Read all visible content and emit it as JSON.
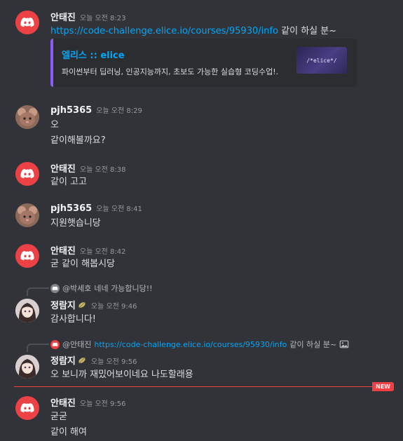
{
  "messages": [
    {
      "username": "안태진",
      "time": "오늘 오전 8:23",
      "link": "https://code-challenge.elice.io/courses/95930/info",
      "text_after_link": " 같이 하실 분~",
      "embed": {
        "title": "엘리스 :: elice",
        "description": "파이썬부터 딥러닝, 인공지능까지, 초보도 가능한 실습형 코딩수업!.",
        "thumb_text": "/*elice*/"
      }
    },
    {
      "username": "pjh5365",
      "time": "오늘 오전 8:29",
      "lines": [
        "오",
        "같이해볼까요?"
      ]
    },
    {
      "username": "안태진",
      "time": "오늘 오전 8:38",
      "lines": [
        "같이 고고"
      ]
    },
    {
      "username": "pjh5365",
      "time": "오늘 오전 8:41",
      "lines": [
        "지원햇습니당"
      ]
    },
    {
      "username": "안태진",
      "time": "오늘 오전 8:42",
      "lines": [
        "굳 같이 해봅시당"
      ]
    },
    {
      "reply": {
        "name": "@박세호",
        "text": " 네네 가능합니당!!"
      },
      "username": "정람지",
      "time": "오늘 오전 9:46",
      "lines": [
        "감사합니다!"
      ]
    },
    {
      "reply": {
        "name": "@안태진",
        "link": "https://code-challenge.elice.io/courses/95930/info",
        "text": " 같이 하실 분~"
      },
      "username": "정람지",
      "time": "오늘 오전 9:56",
      "lines": [
        "오 보니까 재밌어보이네요 나도할래용"
      ]
    },
    {
      "username": "안태진",
      "time": "오늘 오전 9:56",
      "lines": [
        "굳굳",
        "같이 해여"
      ]
    }
  ],
  "new_badge": "NEW",
  "colors": {
    "background": "#313338",
    "link": "#00a8fc",
    "new": "#f23f43",
    "discord": "#ed4245"
  }
}
